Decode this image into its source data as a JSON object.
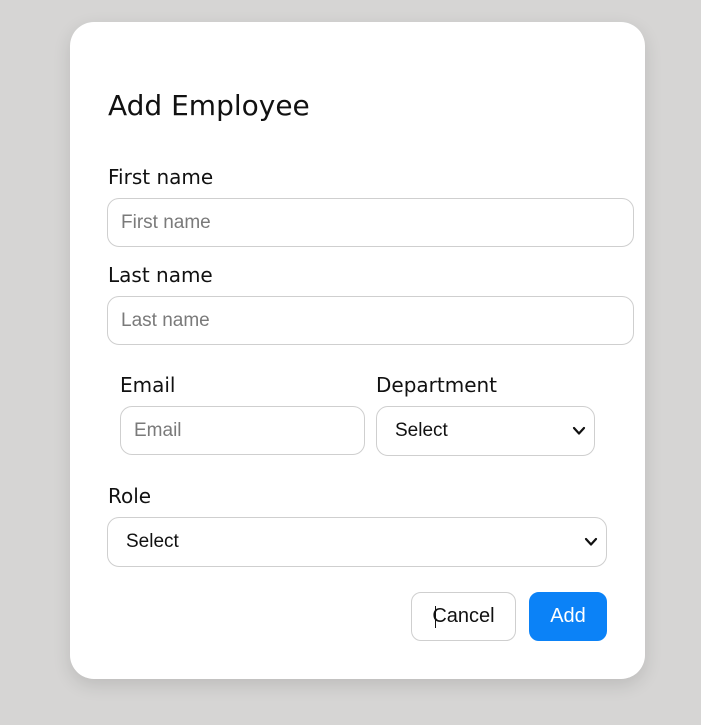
{
  "dialog": {
    "title": "Add Employee",
    "fields": {
      "first_name": {
        "label": "First name",
        "placeholder": "First name",
        "value": ""
      },
      "last_name": {
        "label": "Last name",
        "placeholder": "Last name",
        "value": ""
      },
      "email": {
        "label": "Email",
        "placeholder": "Email",
        "value": ""
      },
      "department": {
        "label": "Department",
        "selected": "Select"
      },
      "role": {
        "label": "Role",
        "selected": "Select"
      }
    },
    "actions": {
      "cancel_label": "Cancel",
      "add_label": "Add"
    }
  },
  "colors": {
    "page_background": "#d6d5d4",
    "dialog_background": "#ffffff",
    "primary_button": "#0b82f7"
  },
  "icons": {
    "select_chevron": "chevron-down-icon"
  }
}
